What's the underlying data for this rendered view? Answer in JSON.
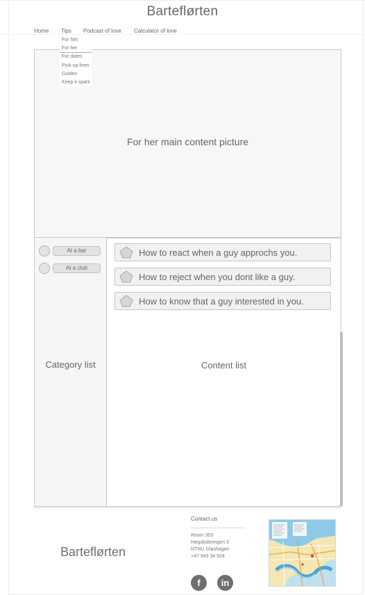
{
  "site": {
    "title": "Barteflørten"
  },
  "nav": {
    "items": [
      {
        "label": "Home"
      },
      {
        "label": "Tips"
      },
      {
        "label": "Podcast of love"
      },
      {
        "label": "Calculator of love"
      }
    ],
    "tips_dropdown": [
      "For him",
      "For her",
      "For dates",
      "Pick-up lines",
      "Guides",
      "Keep it spark"
    ],
    "tips_dropdown_selected": "For her"
  },
  "hero": {
    "label": "For her main content picture"
  },
  "category_panel": {
    "label": "Category list",
    "items": [
      {
        "label": "At a bar"
      },
      {
        "label": "At a club"
      }
    ]
  },
  "content_panel": {
    "label": "Content list",
    "items": [
      {
        "label": "How to react when a guy approchs you."
      },
      {
        "label": "How to reject when you dont like a guy."
      },
      {
        "label": "How to know that a guy interested in you."
      }
    ]
  },
  "footer": {
    "logo": "Barteflørten",
    "contact_title": "Contact us",
    "contact_lines": [
      "Room 303",
      "Høgskoleringen 3",
      "NTNU Gløshagen",
      "+47 943 34 504"
    ],
    "social": [
      {
        "icon": "facebook-icon",
        "glyph": "f"
      },
      {
        "icon": "linkedin-icon",
        "glyph": "in"
      }
    ]
  },
  "colors": {
    "panel_bg": "#f6f6f6",
    "border": "#c9c9c9",
    "text": "#666666",
    "icon": "#6f6f6f"
  }
}
